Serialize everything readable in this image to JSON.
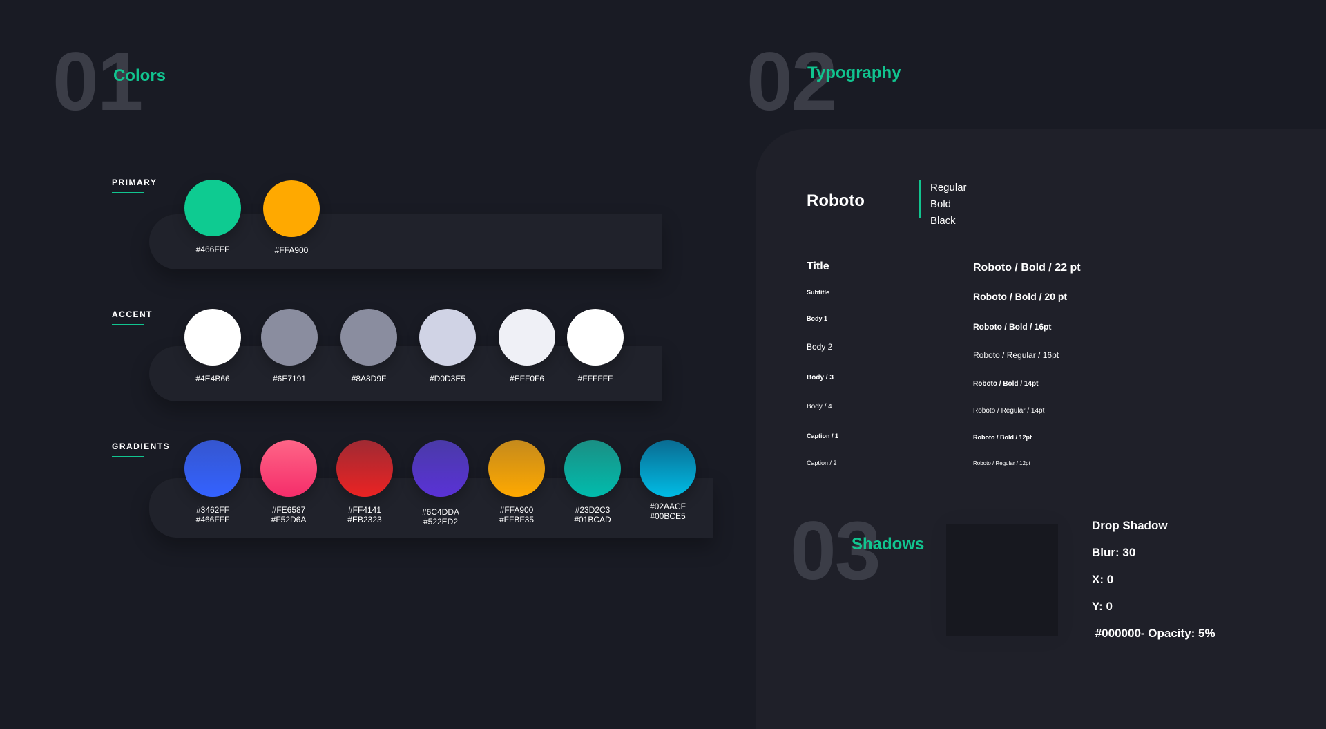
{
  "sections": {
    "colors": {
      "number": "01",
      "title": "Colors"
    },
    "typography": {
      "number": "02",
      "title": "Typography"
    },
    "shadows": {
      "number": "03",
      "title": "Shadows"
    }
  },
  "palette": {
    "primary": {
      "label": "PRIMARY",
      "swatches": [
        {
          "hex": "#466FFF",
          "color": "#0ecb91"
        },
        {
          "hex": "#FFA900",
          "color": "#ffa900"
        }
      ]
    },
    "accent": {
      "label": "ACCENT",
      "swatches": [
        {
          "hex": "#4E4B66",
          "color": "#ffffff"
        },
        {
          "hex": "#6E7191",
          "color": "#8a8d9f"
        },
        {
          "hex": "#8A8D9F",
          "color": "#8a8d9f"
        },
        {
          "hex": "#D0D3E5",
          "color": "#d0d3e5"
        },
        {
          "hex": "#EFF0F6",
          "color": "#eff0f6"
        },
        {
          "hex": "#FFFFFF",
          "color": "#ffffff"
        }
      ]
    },
    "gradients": {
      "label": "GRADIENTS",
      "swatches": [
        {
          "hex1": "#3462FF",
          "hex2": "#466FFF",
          "from": "#3556cf",
          "to": "#3462ff"
        },
        {
          "hex1": "#FE6587",
          "hex2": "#F52D6A",
          "from": "#fe6587",
          "to": "#f52d6a"
        },
        {
          "hex1": "#FF4141",
          "hex2": "#EB2323",
          "from": "#a02a33",
          "to": "#eb2323"
        },
        {
          "hex1": "#6C4DDA",
          "hex2": "#522ED2",
          "from": "#4a3aa8",
          "to": "#5a32d6"
        },
        {
          "hex1": "#FFA900",
          "hex2": "#FFBF35",
          "from": "#c58a1c",
          "to": "#ffa900"
        },
        {
          "hex1": "#23D2C3",
          "hex2": "#01BCAD",
          "from": "#1a8f84",
          "to": "#01bcad"
        },
        {
          "hex1": "#02AACF",
          "hex2": "#00BCE5",
          "from": "#0a6c92",
          "to": "#00bce5"
        }
      ]
    }
  },
  "typography": {
    "font_name": "Roboto",
    "weights": [
      "Regular",
      "Bold",
      "Black"
    ],
    "styles": [
      {
        "label": "Title",
        "spec": "Roboto /  Bold / 22 pt"
      },
      {
        "label": "Subtitle",
        "spec": "Roboto / Bold / 20 pt"
      },
      {
        "label": "Body 1",
        "spec": "Roboto / Bold / 16pt"
      },
      {
        "label": "Body 2",
        "spec": "Roboto / Regular / 16pt"
      },
      {
        "label": "Body / 3",
        "spec": "Roboto / Bold / 14pt"
      },
      {
        "label": "Body / 4",
        "spec": "Roboto / Regular / 14pt"
      },
      {
        "label": "Caption / 1",
        "spec": "Roboto /  Bold / 12pt"
      },
      {
        "label": "Caption / 2",
        "spec": "Roboto / Regular / 12pt"
      }
    ]
  },
  "shadow": {
    "title": "Drop Shadow",
    "blur": "Blur: 30",
    "x": "X: 0",
    "y": "Y: 0",
    "color": " #000000- Opacity: 5%"
  },
  "colors": {
    "background": "#191b24",
    "panel": "#1f2029",
    "accent_green": "#11c48f",
    "number_gray": "#3b3d47"
  }
}
